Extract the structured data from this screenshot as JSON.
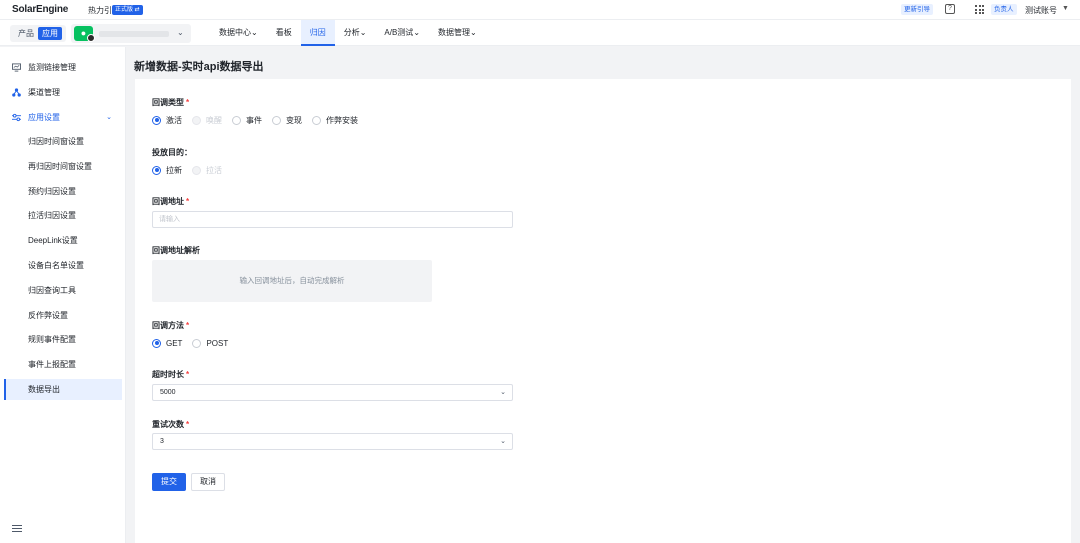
{
  "header": {
    "brand": "SolarEngine",
    "brand_sub": "热力引擎",
    "version_badge": "正式版 ⇄",
    "update_label": "更新引导",
    "owner_badge": "负责人",
    "account_name": "测试账号",
    "help_icon": "help-icon",
    "apps_icon": "grid-apps-icon"
  },
  "switcher": {
    "product_label": "产品",
    "app_label": "应用",
    "app_icon": "wechat-icon"
  },
  "nav": [
    {
      "label": "数据中心",
      "caret": "⌄"
    },
    {
      "label": "看板",
      "caret": ""
    },
    {
      "label": "归因",
      "caret": "",
      "active": true
    },
    {
      "label": "分析",
      "caret": "⌄"
    },
    {
      "label": "A/B测试",
      "caret": "⌄"
    },
    {
      "label": "数据管理",
      "caret": "⌄"
    }
  ],
  "sidebar": {
    "items": [
      {
        "label": "监测链接管理",
        "icon": "monitor-link-icon"
      },
      {
        "label": "渠道管理",
        "icon": "channel-icon"
      },
      {
        "label": "应用设置",
        "icon": "settings-sliders-icon",
        "expanded": true
      }
    ],
    "sub_items": [
      {
        "label": "归因时间窗设置"
      },
      {
        "label": "再归因时间窗设置"
      },
      {
        "label": "预约归因设置"
      },
      {
        "label": "拉活归因设置"
      },
      {
        "label": "DeepLink设置"
      },
      {
        "label": "设备白名单设置"
      },
      {
        "label": "归因查询工具"
      },
      {
        "label": "反作弊设置"
      },
      {
        "label": "规则事件配置"
      },
      {
        "label": "事件上报配置"
      },
      {
        "label": "数据导出",
        "active": true
      }
    ]
  },
  "page": {
    "title": "新增数据-实时api数据导出"
  },
  "form": {
    "callback_type": {
      "label": "回调类型",
      "options": [
        {
          "label": "激活",
          "state": "checked"
        },
        {
          "label": "唤醒",
          "state": "disabled"
        },
        {
          "label": "事件",
          "state": "normal"
        },
        {
          "label": "变现",
          "state": "normal"
        },
        {
          "label": "作弊安装",
          "state": "normal"
        }
      ]
    },
    "purpose": {
      "label": "投放目的：",
      "options": [
        {
          "label": "拉新",
          "state": "checked"
        },
        {
          "label": "拉活",
          "state": "disabled"
        }
      ]
    },
    "callback_url": {
      "label": "回调地址",
      "placeholder": "请输入",
      "value": ""
    },
    "url_parse": {
      "label": "回调地址解析",
      "hint": "输入回调地址后，自动完成解析"
    },
    "method": {
      "label": "回调方法",
      "options": [
        {
          "label": "GET",
          "state": "checked"
        },
        {
          "label": "POST",
          "state": "normal"
        }
      ]
    },
    "timeout": {
      "label": "超时时长",
      "value": "5000"
    },
    "retries": {
      "label": "重试次数",
      "value": "3"
    },
    "required_mark": "*",
    "submit_label": "提交",
    "cancel_label": "取消"
  }
}
